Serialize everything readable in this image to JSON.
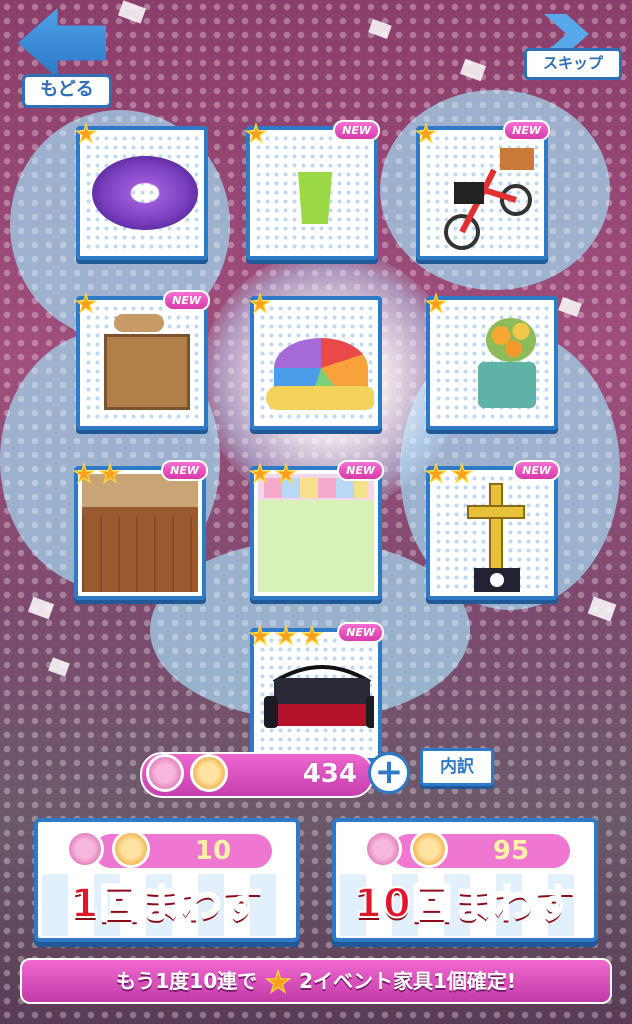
{
  "header": {
    "back_label": "もどる",
    "skip_label": "スキップ"
  },
  "items": [
    {
      "name": "purple-donut-cushion",
      "stars": 1,
      "is_new": false,
      "new_label": ""
    },
    {
      "name": "green-waste-basket",
      "stars": 1,
      "is_new": true,
      "new_label": "NEW"
    },
    {
      "name": "red-delivery-bicycle",
      "stars": 1,
      "is_new": true,
      "new_label": "NEW"
    },
    {
      "name": "welcome-wooden-counter",
      "stars": 1,
      "is_new": true,
      "new_label": "NEW"
    },
    {
      "name": "colorful-tent-cushion",
      "stars": 1,
      "is_new": false,
      "new_label": ""
    },
    {
      "name": "flower-watering-can",
      "stars": 1,
      "is_new": false,
      "new_label": ""
    },
    {
      "name": "wooden-room-wallpaper",
      "stars": 2,
      "is_new": true,
      "new_label": "NEW"
    },
    {
      "name": "shop-street-floor",
      "stars": 2,
      "is_new": true,
      "new_label": "NEW"
    },
    {
      "name": "golden-cross-statue",
      "stars": 2,
      "is_new": true,
      "new_label": "NEW"
    },
    {
      "name": "black-ornate-sofa",
      "stars": 3,
      "is_new": true,
      "new_label": "NEW"
    }
  ],
  "currency": {
    "amount": "434",
    "plus": "+",
    "detail_label": "内訳"
  },
  "gacha": {
    "single": {
      "cost": "10",
      "label": "1回まわす"
    },
    "multi": {
      "cost": "95",
      "label": "10回まわす"
    }
  },
  "banner": {
    "prefix": "もう1度10連で",
    "suffix": "2イベント家具1個確定!"
  },
  "colors": {
    "accent_blue": "#2e7ac7",
    "accent_pink": "#ee66cf",
    "cost_text": "#fff2a8",
    "gacha_label": "#e2162b"
  }
}
